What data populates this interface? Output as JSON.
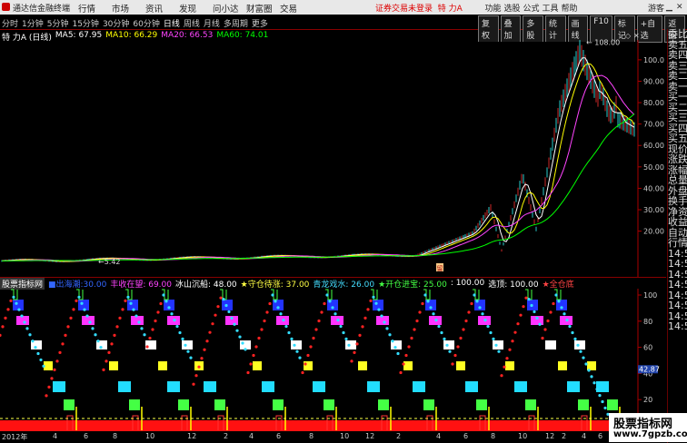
{
  "app": {
    "title": "通达信金融终端",
    "alert": "证券交易未登录",
    "stock_tag": "特 力A",
    "guest": "游客"
  },
  "menu": [
    "行情",
    "市场",
    "资讯",
    "发现",
    "问小达",
    "财富圈",
    "交易"
  ],
  "top_right": [
    "功能",
    "选股",
    "公式",
    "工具",
    "帮助"
  ],
  "periods": [
    "分时",
    "1分钟",
    "5分钟",
    "15分钟",
    "30分钟",
    "60分钟",
    "日线",
    "周线",
    "月线",
    "多周期",
    "更多"
  ],
  "active_period": "日线",
  "tools": [
    "复权",
    "叠加",
    "多股",
    "统计",
    "画线",
    "F10",
    "标记",
    "+自选",
    "返回"
  ],
  "chart": {
    "name": "特 力A (日线)",
    "ma": [
      {
        "label": "MA5: 67.95",
        "color": "#ffffff"
      },
      {
        "label": "MA10: 66.29",
        "color": "#ffff00"
      },
      {
        "label": "MA20: 66.53",
        "color": "#ff44ff"
      },
      {
        "label": "MA60: 74.01",
        "color": "#00ff00"
      }
    ],
    "high_label": "108.00",
    "low_label": "5.42",
    "event_mark": "留",
    "price_axis": [
      "100.0",
      "90.00",
      "80.00",
      "70.00",
      "60.00",
      "50.00",
      "40.00",
      "30.00",
      "20.00"
    ],
    "indicator_axis": [
      "100",
      "80",
      "60",
      "40",
      "20",
      "0"
    ]
  },
  "indicator": {
    "name": "股票指标网",
    "labels": [
      {
        "text": "■出海潮:30.00",
        "color": "#3366ff"
      },
      {
        "text": "丰收在望: 69.00",
        "color": "#ff44ff"
      },
      {
        "text": "冰山沉船: 48.00",
        "color": "#ffffff"
      },
      {
        "text": "★守仓待涨: 37.00",
        "color": "#ffff44"
      },
      {
        "text": "青龙戏水: 26.00",
        "color": "#44ddff"
      },
      {
        "text": "★开仓进宝: 25.00",
        "color": "#44ff44"
      },
      {
        "text": ": 100.00",
        "color": "#ffffff"
      },
      {
        "text": "选顶: 100.00",
        "color": "#ffffff"
      },
      {
        "text": "★全仓底",
        "color": "#ff4444"
      }
    ],
    "right_value": "42.87"
  },
  "right_panel": [
    {
      "t": "委比",
      "c": "w"
    },
    {
      "t": "卖五",
      "c": "w"
    },
    {
      "t": "卖四",
      "c": "w"
    },
    {
      "t": "卖三",
      "c": "w"
    },
    {
      "t": "卖二",
      "c": "w"
    },
    {
      "t": "卖一",
      "c": "w"
    },
    {
      "t": "买一",
      "c": "w"
    },
    {
      "t": "买二",
      "c": "w"
    },
    {
      "t": "买三",
      "c": "w"
    },
    {
      "t": "买四",
      "c": "w"
    },
    {
      "t": "买五",
      "c": "w"
    },
    {
      "t": "现价",
      "c": "w"
    },
    {
      "t": "涨跌",
      "c": "w"
    },
    {
      "t": "涨幅",
      "c": "w"
    },
    {
      "t": "总量",
      "c": "w"
    },
    {
      "t": "外盘",
      "c": "w"
    },
    {
      "t": "换手",
      "c": "w"
    },
    {
      "t": "净资",
      "c": "w"
    },
    {
      "t": "收益",
      "c": "w"
    },
    {
      "t": "自动",
      "c": "w"
    },
    {
      "t": "行情",
      "c": "w"
    },
    {
      "t": "14:5",
      "c": "w"
    },
    {
      "t": "14:5",
      "c": "w"
    },
    {
      "t": "14:5",
      "c": "w"
    },
    {
      "t": "14:5",
      "c": "w"
    },
    {
      "t": "14:5",
      "c": "w"
    },
    {
      "t": "14:5",
      "c": "w"
    },
    {
      "t": "14:5",
      "c": "w"
    },
    {
      "t": "14:5",
      "c": "w"
    }
  ],
  "bottom_axis": [
    "2012年",
    "4",
    "6",
    "8",
    "10",
    "12",
    "2",
    "4",
    "6",
    "8",
    "10",
    "12",
    "2",
    "4",
    "6",
    "8",
    "10",
    "12",
    "2",
    "4",
    "6",
    "8",
    "11",
    "12"
  ],
  "watermark": {
    "line1": "股票指标网",
    "line2": "www.7gpzb.com"
  }
}
